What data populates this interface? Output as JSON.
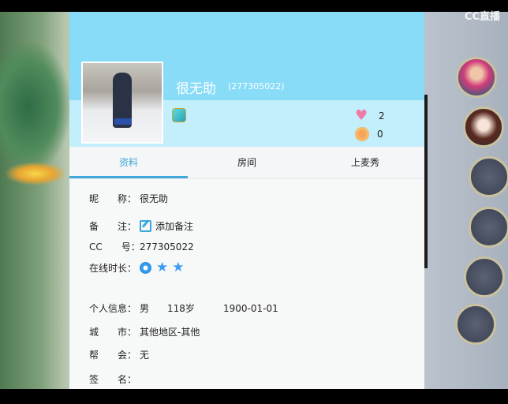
{
  "watermark": "CC直播",
  "profile": {
    "name": "很无助",
    "cc_id_display": "(277305022)",
    "likes": "2",
    "lollipops": "0"
  },
  "tabs": [
    {
      "label": "资料",
      "active": true
    },
    {
      "label": "房间",
      "active": false
    },
    {
      "label": "上麦秀",
      "active": false
    }
  ],
  "info": {
    "nickname_label": "昵　　称：",
    "nickname": "很无助",
    "remark_label": "备　　注：",
    "remark_action": "添加备注",
    "cc_label": "CC　　号：",
    "cc": "277305022",
    "online_label": "在线时长：",
    "personal_label": "个人信息：",
    "gender": "男",
    "age": "118岁",
    "birthday": "1900-01-01",
    "city_label": "城　　市：",
    "city": "其他地区-其他",
    "guild_label": "帮　　会：",
    "guild": "无",
    "signature_label": "签　　名：",
    "signature": ""
  }
}
